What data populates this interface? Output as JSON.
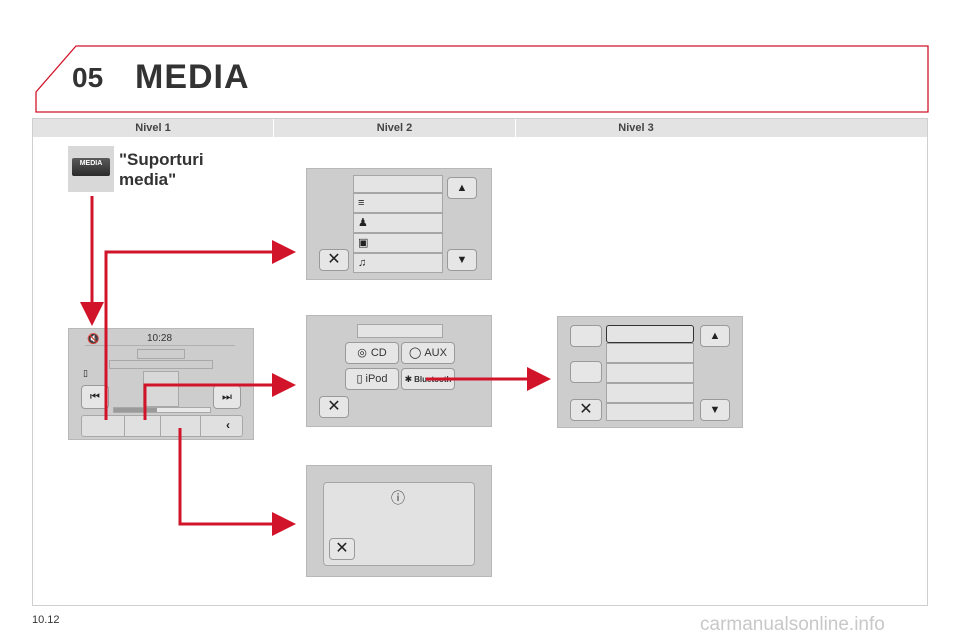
{
  "header": {
    "section_number": "05",
    "title": "MEDIA"
  },
  "columns": {
    "level1": "Nivel 1",
    "level2": "Nivel 2",
    "level3": "Nivel 3"
  },
  "media_key": {
    "label": "MEDIA"
  },
  "caption": {
    "line1": "\"Suporturi",
    "line2": "media\""
  },
  "player": {
    "time": "10:28"
  },
  "sources": {
    "cd": "CD",
    "aux": "AUX",
    "ipod": "iPod",
    "bluetooth": "Bluetooth"
  },
  "page_number": "10.12",
  "watermark": "carmanualsonline.info",
  "colors": {
    "accent_red": "#d2142a",
    "screen_grey": "#cdcdcd",
    "header_band": "#e3e3e3"
  }
}
